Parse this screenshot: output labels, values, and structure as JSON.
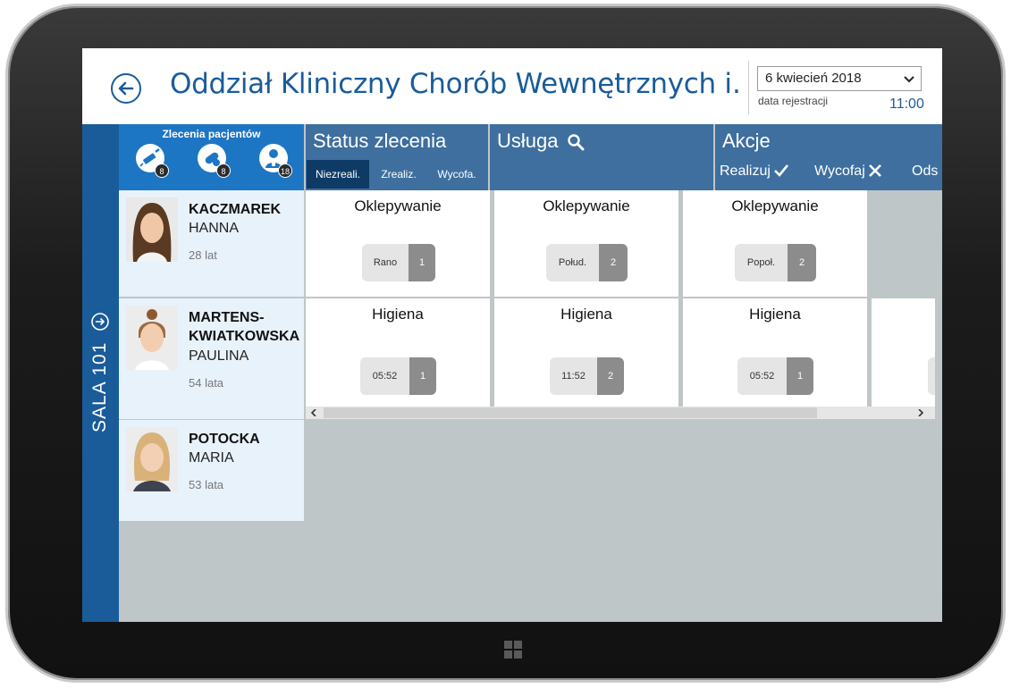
{
  "header": {
    "title": "Oddział Kliniczny Chorób Wewnętrznych i…",
    "date_selected": "6 kwiecień 2018",
    "date_label": "data rejestracji",
    "time": "11:00"
  },
  "room": {
    "label": "SALA 101"
  },
  "orders": {
    "title": "Zlecenia pacjentów",
    "icons": [
      {
        "icon": "syringe-icon",
        "count": "8"
      },
      {
        "icon": "pills-icon",
        "count": "8"
      },
      {
        "icon": "nurse-icon",
        "count": "18"
      }
    ]
  },
  "columns": {
    "status": {
      "title": "Status zlecenia",
      "tabs": [
        "Niezreali.",
        "Zrealiz.",
        "Wycofa."
      ]
    },
    "service": {
      "title": "Usługa"
    },
    "actions": {
      "title": "Akcje",
      "buttons": [
        "Realizuj",
        "Wycofaj",
        "Ods"
      ]
    }
  },
  "patients": [
    {
      "last_name": "KACZMAREK",
      "first_name": "HANNA",
      "age": "28 lat",
      "orders": [
        {
          "title": "Oklepywanie",
          "label": "Rano",
          "num": "1"
        },
        {
          "title": "Oklepywanie",
          "label": "Połud.",
          "num": "2"
        },
        {
          "title": "Oklepywanie",
          "label": "Popoł.",
          "num": "2"
        }
      ]
    },
    {
      "last_name_1": "MARTENS-",
      "last_name_2": "KWIATKOWSKA",
      "first_name": "PAULINA",
      "age": "54 lata",
      "orders": [
        {
          "title": "Higiena",
          "label": "05:52",
          "num": "1"
        },
        {
          "title": "Higiena",
          "label": "11:52",
          "num": "2"
        },
        {
          "title": "Higiena",
          "label": "05:52",
          "num": "1"
        }
      ]
    },
    {
      "last_name": "POTOCKA",
      "first_name": "MARIA",
      "age": "53 lata"
    }
  ],
  "colors": {
    "primary": "#1a5c9a",
    "orders_header": "#1d76c4",
    "column_header": "#3e6f9f",
    "active_tab": "#0e3a66",
    "patient_bg": "#e8f2fb",
    "screen_bg": "#bfc6c7"
  }
}
